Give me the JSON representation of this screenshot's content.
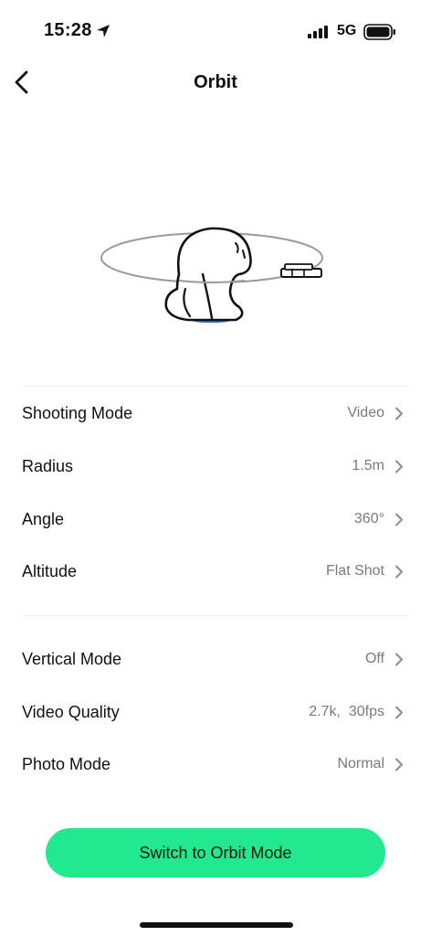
{
  "status_bar": {
    "time": "15:28",
    "network": "5G",
    "icons": [
      "location-arrow-icon",
      "signal-icon",
      "battery-icon"
    ]
  },
  "nav": {
    "title": "Orbit",
    "back_icon": "chevron-left-icon"
  },
  "settings": {
    "group1": [
      {
        "label": "Shooting Mode",
        "value": "Video"
      },
      {
        "label": "Radius",
        "value": "1.5m"
      },
      {
        "label": "Angle",
        "value": "360°"
      },
      {
        "label": "Altitude",
        "value": "Flat Shot"
      }
    ],
    "group2": [
      {
        "label": "Vertical Mode",
        "value": "Off"
      },
      {
        "label": "Video Quality",
        "value": "2.7k,  30fps"
      },
      {
        "label": "Photo Mode",
        "value": "Normal"
      }
    ]
  },
  "cta": {
    "label": "Switch to Orbit Mode",
    "color": "#22e88f"
  }
}
